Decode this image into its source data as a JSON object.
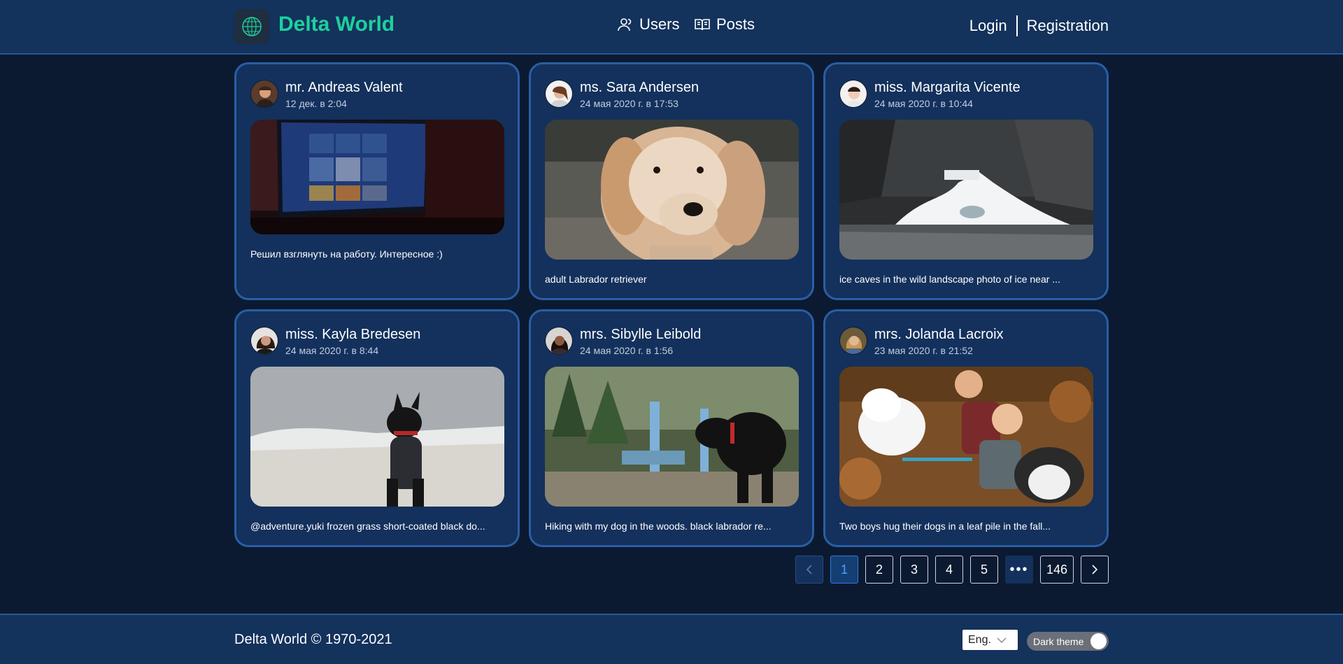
{
  "app": {
    "title": "Delta World",
    "nav": {
      "users": "Users",
      "posts": "Posts"
    },
    "auth": {
      "login": "Login",
      "registration": "Registration"
    }
  },
  "posts": [
    {
      "author": "mr. Andreas Valent",
      "date": "12 дек. в 2:04",
      "caption": "Решил взглянуть на работу. Интересное :)",
      "image": "laptop-screen-photo"
    },
    {
      "author": "ms. Sara Andersen",
      "date": "24 мая 2020 г. в 17:53",
      "caption": "adult Labrador retriever",
      "image": "golden-retriever-photo"
    },
    {
      "author": "miss. Margarita Vicente",
      "date": "24 мая 2020 г. в 10:44",
      "caption": "ice caves in the wild landscape photo of ice near ...",
      "image": "ice-cave-photo"
    },
    {
      "author": "miss. Kayla Bredesen",
      "date": "24 мая 2020 г. в 8:44",
      "caption": "@adventure.yuki frozen grass short-coated black do...",
      "image": "black-dog-snow-photo"
    },
    {
      "author": "mrs. Sibylle Leibold",
      "date": "24 мая 2020 г. в 1:56",
      "caption": "Hiking with my dog in the woods. black labrador re...",
      "image": "black-labrador-woods-photo"
    },
    {
      "author": "mrs. Jolanda Lacroix",
      "date": "23 мая 2020 г. в 21:52",
      "caption": "Two boys hug their dogs in a leaf pile in the fall...",
      "image": "boys-dogs-leaves-photo"
    }
  ],
  "pagination": {
    "prev": "<",
    "pages": [
      "1",
      "2",
      "3",
      "4",
      "5"
    ],
    "ellipsis": "•••",
    "last": "146",
    "next": ">",
    "current": "1"
  },
  "footer": {
    "copyright": "Delta World © 1970-2021",
    "language": "Eng.",
    "theme_label": "Dark theme",
    "theme_on": true
  },
  "colors": {
    "brand": "#1ed09d",
    "header_bg": "#13325c",
    "page_bg": "#0b1a31",
    "card_border": "#2a5ea6",
    "active_page": "#4aa0ff"
  }
}
